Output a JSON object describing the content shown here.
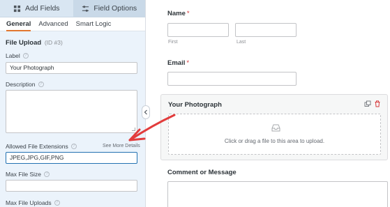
{
  "left_panel": {
    "tabs": [
      {
        "label": "Add Fields",
        "icon": "grid-icon"
      },
      {
        "label": "Field Options",
        "icon": "sliders-icon"
      }
    ],
    "subtabs": [
      "General",
      "Advanced",
      "Smart Logic"
    ],
    "field_title": "File Upload",
    "field_id": "(ID #3)",
    "label_caption": "Label",
    "label_value": "Your Photograph",
    "description_caption": "Description",
    "extensions_caption": "Allowed File Extensions",
    "extensions_link": "See More Details",
    "extensions_value": "JPEG,JPG,GIF,PNG",
    "max_size_caption": "Max File Size",
    "max_uploads_caption": "Max File Uploads",
    "help_glyph": "?"
  },
  "form_preview": {
    "name_label": "Name",
    "required_mark": "*",
    "first_label": "First",
    "last_label": "Last",
    "email_label": "Email",
    "upload_label": "Your Photograph",
    "upload_hint": "Click or drag a file to this area to upload.",
    "comment_label": "Comment or Message"
  },
  "colors": {
    "accent": "#e27730",
    "arrow": "#e23c3c",
    "panel_bg": "#ebf3fb",
    "focus_border": "#2271b1"
  }
}
